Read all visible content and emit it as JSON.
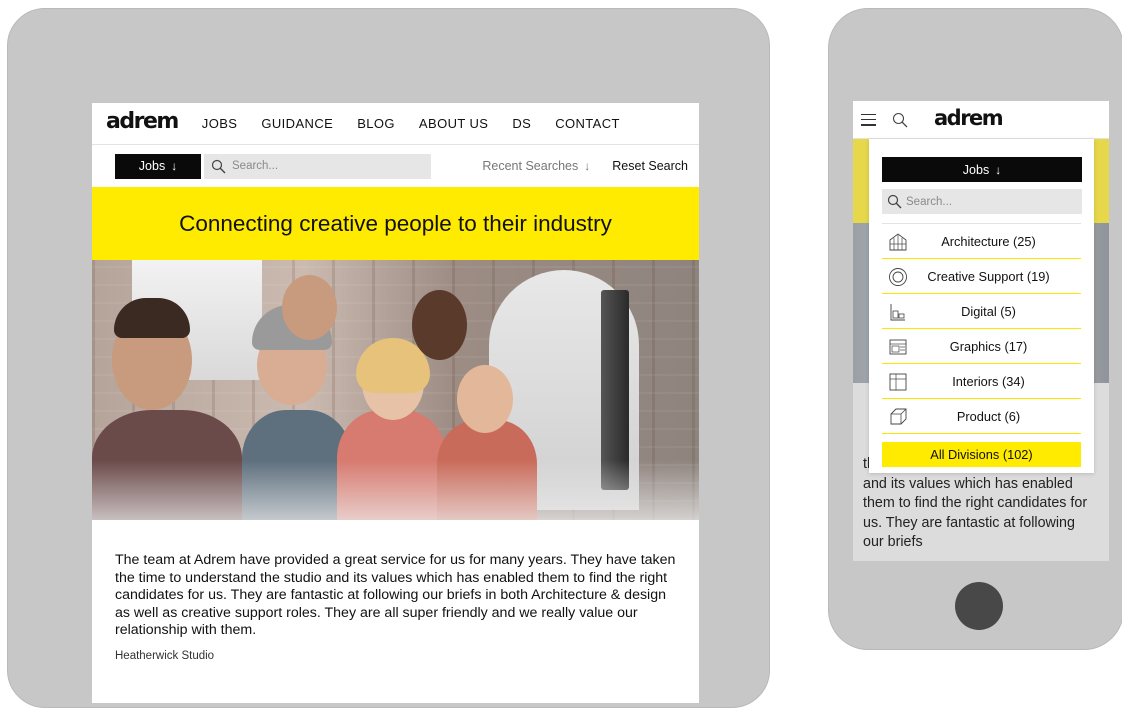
{
  "brand": {
    "logo_text": "adrem",
    "accent": "#ffeb00",
    "dark": "#0a0a0a"
  },
  "tablet": {
    "nav": {
      "items": [
        "JOBS",
        "GUIDANCE",
        "BLOG",
        "ABOUT US",
        "DS",
        "CONTACT"
      ]
    },
    "search": {
      "jobs_label": "Jobs",
      "placeholder": "Search...",
      "recent_label": "Recent Searches",
      "reset_label": "Reset Search"
    },
    "hero": {
      "headline": "Connecting creative people to their industry"
    },
    "testimonial": {
      "quote": "The team at Adrem have provided a great service for us for many years. They have taken the time to understand the studio and its values which has enabled them to find the right candidates for us. They are fantastic at following our briefs in both Architecture & design as well as creative support roles. They are all super friendly and we really value our relationship with them.",
      "author": "Heatherwick Studio"
    }
  },
  "phone": {
    "dropdown": {
      "jobs_label": "Jobs",
      "placeholder": "Search...",
      "items": [
        {
          "label": "Architecture (25)",
          "icon": "architecture-icon"
        },
        {
          "label": "Creative Support (19)",
          "icon": "creative-support-icon"
        },
        {
          "label": "Digital (5)",
          "icon": "digital-icon"
        },
        {
          "label": "Graphics (17)",
          "icon": "graphics-icon"
        },
        {
          "label": "Interiors (34)",
          "icon": "interiors-icon"
        },
        {
          "label": "Product (6)",
          "icon": "product-icon"
        }
      ],
      "all_label": "All Divisions (102)"
    },
    "underlay_text": "the time to understand the studio and its values which has enabled them to find the right candidates for us. They are fantastic at following our briefs"
  }
}
